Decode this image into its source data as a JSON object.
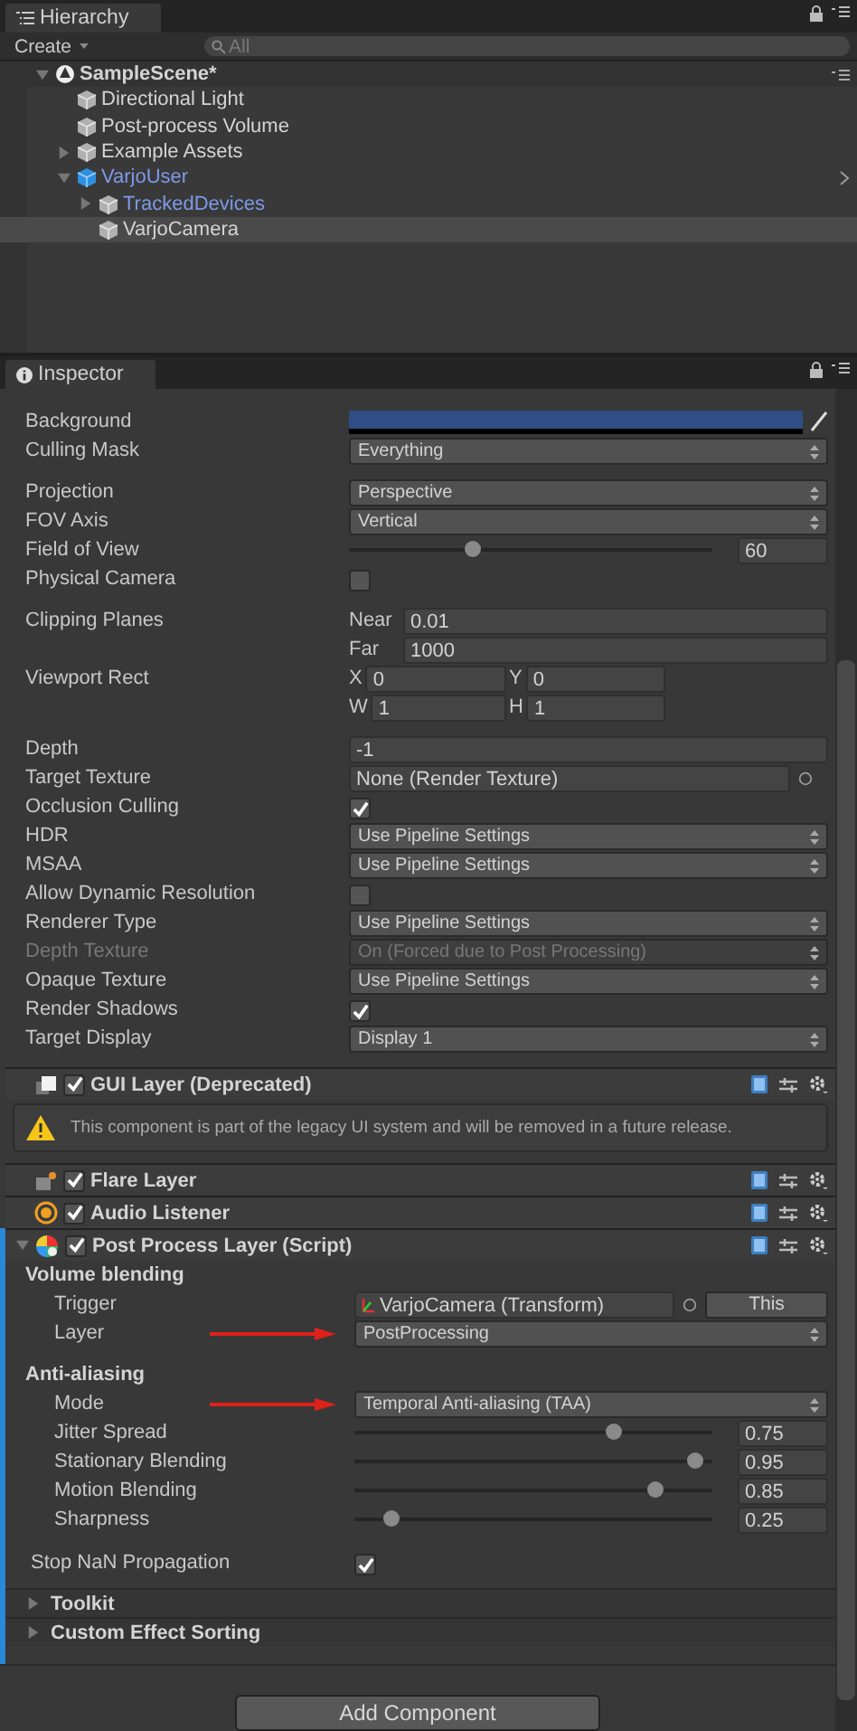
{
  "hierarchy": {
    "tab": "Hierarchy",
    "create": "Create",
    "search_placeholder": "All",
    "items": [
      {
        "label": "SampleScene*",
        "kind": "scene",
        "expanded": true,
        "selected": false,
        "children": [
          {
            "label": "Directional Light",
            "kind": "object",
            "selected": false
          },
          {
            "label": "Post-process Volume",
            "kind": "object",
            "selected": false
          },
          {
            "label": "Example Assets",
            "kind": "object",
            "expanded": false,
            "selected": false
          },
          {
            "label": "VarjoUser",
            "kind": "prefab_root",
            "expanded": true,
            "selected": false,
            "children": [
              {
                "label": "TrackedDevices",
                "kind": "prefab",
                "expanded": false,
                "selected": false
              },
              {
                "label": "VarjoCamera",
                "kind": "object",
                "selected": true
              }
            ]
          }
        ]
      }
    ]
  },
  "inspector": {
    "tab": "Inspector",
    "camera_groups": [
      [
        {
          "label": "Background",
          "kind": "color",
          "color": "#2f4e86"
        },
        {
          "label": "Culling Mask",
          "kind": "dropdown",
          "value": "Everything"
        }
      ],
      [
        {
          "label": "Projection",
          "kind": "dropdown",
          "value": "Perspective"
        },
        {
          "label": "FOV Axis",
          "kind": "dropdown",
          "value": "Vertical"
        },
        {
          "label": "Field of View",
          "kind": "slider",
          "level": 0.34,
          "value": "60"
        },
        {
          "label": "Physical Camera",
          "kind": "checkbox",
          "checked": false
        }
      ],
      [
        {
          "label": "Clipping Planes",
          "kind": "pair",
          "fields": [
            {
              "label": "Near",
              "value": "0.01"
            },
            {
              "label": "Far",
              "value": "1000"
            }
          ]
        },
        {
          "label": "Viewport Rect",
          "kind": "rect",
          "fields": [
            {
              "label": "X",
              "value": "0"
            },
            {
              "label": "Y",
              "value": "0"
            },
            {
              "label": "W",
              "value": "1"
            },
            {
              "label": "H",
              "value": "1"
            }
          ]
        }
      ],
      [
        {
          "label": "Depth",
          "kind": "text",
          "value": "-1"
        },
        {
          "label": "Target Texture",
          "kind": "object",
          "value": "None (Render Texture)"
        },
        {
          "label": "Occlusion Culling",
          "kind": "checkbox",
          "checked": true
        },
        {
          "label": "HDR",
          "kind": "dropdown",
          "value": "Use Pipeline Settings"
        },
        {
          "label": "MSAA",
          "kind": "dropdown",
          "value": "Use Pipeline Settings"
        },
        {
          "label": "Allow Dynamic Resolution",
          "kind": "checkbox",
          "checked": false
        },
        {
          "label": "Renderer Type",
          "kind": "dropdown",
          "value": "Use Pipeline Settings"
        },
        {
          "label": "Depth Texture",
          "kind": "dropdown",
          "value": "On (Forced due to Post Processing)",
          "disabled": true
        },
        {
          "label": "Opaque Texture",
          "kind": "dropdown",
          "value": "Use Pipeline Settings"
        },
        {
          "label": "Render Shadows",
          "kind": "checkbox",
          "checked": true
        },
        {
          "label": "Target Display",
          "kind": "dropdown",
          "value": "Display 1"
        }
      ]
    ],
    "components": [
      {
        "title": "GUI Layer (Deprecated)",
        "kind": "gui",
        "enabled": true,
        "message": "This component is part of the legacy UI system and will be removed in a future release."
      },
      {
        "title": "Flare Layer",
        "kind": "flare",
        "enabled": true
      },
      {
        "title": "Audio Listener",
        "kind": "audio",
        "enabled": true
      },
      {
        "title": "Post Process Layer (Script)",
        "kind": "postprocess",
        "enabled": true,
        "expanded": true,
        "highlighted": true,
        "sections": [
          {
            "title": "Volume blending",
            "rows": [
              {
                "label": "Trigger",
                "kind": "object_button",
                "value": "VarjoCamera (Transform)",
                "button": "This"
              },
              {
                "label": "Layer",
                "kind": "dropdown",
                "value": "PostProcessing",
                "arrow": true
              }
            ]
          },
          {
            "title": "Anti-aliasing",
            "rows": [
              {
                "label": "Mode",
                "kind": "dropdown",
                "value": "Temporal Anti-aliasing (TAA)",
                "arrow": true
              },
              {
                "label": "Jitter Spread",
                "kind": "slider",
                "level": 0.72,
                "value": "0.75"
              },
              {
                "label": "Stationary Blending",
                "kind": "slider",
                "level": 0.95,
                "value": "0.95"
              },
              {
                "label": "Motion Blending",
                "kind": "slider",
                "level": 0.84,
                "value": "0.85"
              },
              {
                "label": "Sharpness",
                "kind": "slider",
                "level": 0.1,
                "value": "0.25"
              }
            ]
          }
        ],
        "rows": [
          {
            "label": "Stop NaN Propagation",
            "kind": "checkbox",
            "checked": true
          }
        ],
        "foldouts": [
          {
            "label": "Toolkit",
            "expanded": false
          },
          {
            "label": "Custom Effect Sorting",
            "expanded": false
          }
        ]
      }
    ],
    "add_button": "Add Component"
  }
}
